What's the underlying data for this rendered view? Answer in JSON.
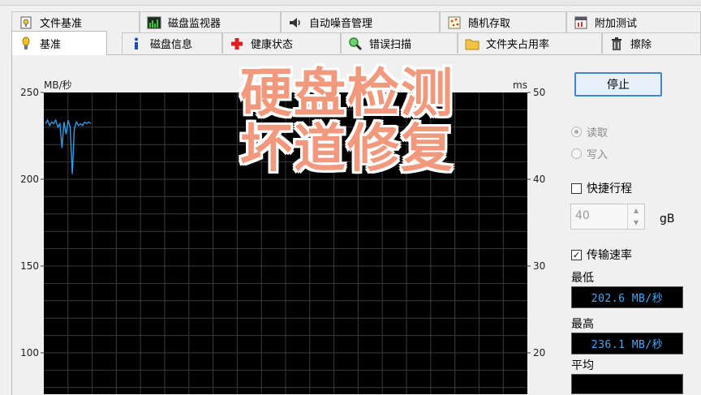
{
  "tabs_row1": [
    {
      "label": "文件基准",
      "icon": "file-benchmark-icon"
    },
    {
      "label": "磁盘监视器",
      "icon": "disk-monitor-icon"
    },
    {
      "label": "自动噪音管理",
      "icon": "speaker-icon"
    },
    {
      "label": "随机存取",
      "icon": "random-access-icon"
    },
    {
      "label": "附加测试",
      "icon": "extra-tests-icon"
    }
  ],
  "tabs_row2": [
    {
      "label": "基准",
      "icon": "benchmark-icon",
      "active": true
    },
    {
      "label": "磁盘信息",
      "icon": "info-icon"
    },
    {
      "label": "健康状态",
      "icon": "health-cross-icon"
    },
    {
      "label": "错误扫描",
      "icon": "magnifier-icon"
    },
    {
      "label": "文件夹占用率",
      "icon": "folder-icon"
    },
    {
      "label": "擦除",
      "icon": "trash-icon"
    }
  ],
  "chart": {
    "left_unit": "MB/秒",
    "right_unit": "ms",
    "left_ticks": [
      "250",
      "200",
      "150",
      "100"
    ],
    "right_ticks": [
      "50",
      "40",
      "30",
      "20"
    ],
    "line_color": "#2f9de8",
    "bg_color": "#000000",
    "grid_color": "#3a3a3a"
  },
  "chart_data": {
    "type": "line",
    "series": [
      {
        "x": [
          0,
          0.5,
          1,
          1.5,
          2,
          2.5,
          3,
          3.5,
          4,
          4.5,
          5,
          5.5,
          6,
          6.5,
          7,
          7.5,
          8,
          8.5,
          9,
          9.5,
          10,
          10.5,
          11
        ],
        "values": [
          232,
          234,
          231,
          233,
          232,
          234,
          230,
          232,
          218,
          233,
          226,
          234,
          230,
          203,
          229,
          233,
          231,
          232,
          231,
          233,
          232,
          233,
          232
        ]
      }
    ],
    "ylabel": "MB/秒",
    "y2label": "ms",
    "ylim": [
      0,
      250
    ],
    "y2lim": [
      0,
      50
    ],
    "grid": true
  },
  "controls": {
    "stop_button": "停止",
    "read_label": "读取",
    "write_label": "写入",
    "short_stroke_label": "快捷行程",
    "short_stroke_value": "40",
    "unit_label": "gB",
    "transfer_rate_label": "传输速率",
    "transfer_rate_checked": true,
    "min_label": "最低",
    "min_value": "202.6 MB/秒",
    "max_label": "最高",
    "max_value": "236.1 MB/秒",
    "avg_label": "平均",
    "avg_value": ""
  },
  "overlay": {
    "line1": "硬盘检测",
    "line2": "坏道修复",
    "color": "#f1987d"
  }
}
